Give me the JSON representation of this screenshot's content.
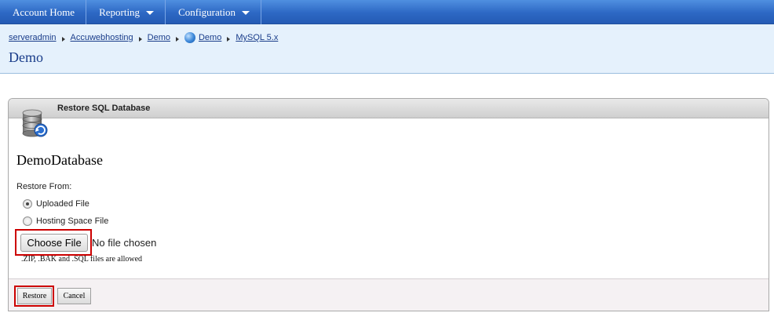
{
  "nav": {
    "items": [
      {
        "label": "Account Home",
        "has_menu": false
      },
      {
        "label": "Reporting",
        "has_menu": true
      },
      {
        "label": "Configuration",
        "has_menu": true
      }
    ]
  },
  "breadcrumb": {
    "items": [
      "serveradmin",
      "Accuwebhosting",
      "Demo",
      "Demo",
      "MySQL 5.x"
    ]
  },
  "page": {
    "title": "Demo"
  },
  "panel": {
    "title": "Restore SQL Database",
    "database_name": "DemoDatabase",
    "restore_from_label": "Restore From:",
    "options": [
      {
        "label": "Uploaded File",
        "selected": true
      },
      {
        "label": "Hosting Space File",
        "selected": false
      }
    ],
    "file_button_label": "Choose File",
    "file_status": "No file chosen",
    "allowed_note": ".ZIP, .BAK and .SQL files are allowed"
  },
  "buttons": {
    "restore": "Restore",
    "cancel": "Cancel"
  },
  "colors": {
    "nav_bg": "#2d68c4",
    "header_bg": "#e5f1fc",
    "link": "#1a3d8a",
    "highlight": "#cc0000"
  },
  "icons": [
    "chevron-down-icon",
    "breadcrumb-arrow-icon",
    "globe-icon",
    "database-restore-icon"
  ]
}
